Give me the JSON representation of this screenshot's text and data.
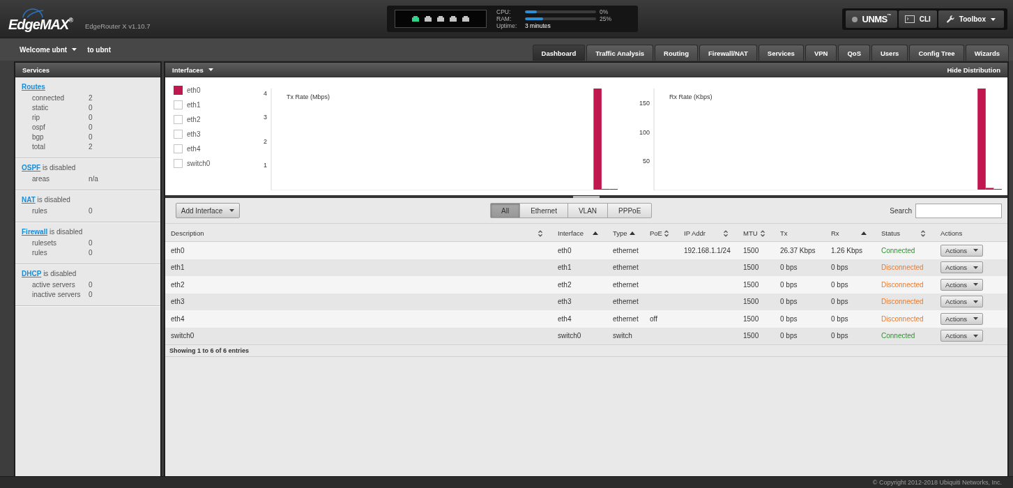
{
  "header": {
    "logo": "EdgeMAX$^{®}$",
    "model": "EdgeRouter X v1.10.7",
    "ports": [
      {
        "link": true
      },
      {
        "link": false
      },
      {
        "link": false
      },
      {
        "link": false
      },
      {
        "link": false
      }
    ],
    "stats": [
      {
        "label": "CPU:",
        "level": 0.17,
        "reading": "0%"
      },
      {
        "label": "RAM:",
        "level": 0.25,
        "reading": "25%"
      }
    ],
    "uptime": {
      "label": "Uptime:",
      "value": "3 minutes"
    },
    "tools": [
      {
        "kind": "unms",
        "label": "UNMS$^{™}$",
        "connected": false
      },
      {
        "kind": "cli",
        "label": "CLI"
      },
      {
        "kind": "toolbox",
        "label": "Toolbox"
      }
    ]
  },
  "user_bar": {
    "welcome": "Welcome ubnt",
    "target": "to ubnt"
  },
  "tabs": [
    {
      "label": "Dashboard",
      "selected": true
    },
    {
      "label": "Traffic Analysis",
      "selected": false
    },
    {
      "label": "Routing",
      "selected": false
    },
    {
      "label": "Firewall/NAT",
      "selected": false
    },
    {
      "label": "Services",
      "selected": false
    },
    {
      "label": "VPN",
      "selected": false
    },
    {
      "label": "QoS",
      "selected": false
    },
    {
      "label": "Users",
      "selected": false
    },
    {
      "label": "Config Tree",
      "selected": false
    },
    {
      "label": "Wizards",
      "selected": false
    }
  ],
  "sidebar": {
    "title": "Services",
    "sections": [
      {
        "link": "Routes",
        "rows": [
          {
            "label": "connected",
            "value": "2"
          },
          {
            "label": "static",
            "value": "0"
          },
          {
            "label": "rip",
            "value": "0"
          },
          {
            "label": "ospf",
            "value": "0"
          },
          {
            "label": "bgp",
            "value": "0"
          },
          {
            "label": "total",
            "value": "2"
          }
        ]
      },
      {
        "link": "OSPF",
        "note": "is disabled",
        "rows": [
          {
            "label": "areas",
            "value": "n/a"
          }
        ]
      },
      {
        "link": "NAT",
        "note": "is disabled",
        "rows": [
          {
            "label": "rules",
            "value": "0"
          }
        ]
      },
      {
        "link": "Firewall",
        "note": "is disabled",
        "rows": [
          {
            "label": "rulesets",
            "value": "0"
          },
          {
            "label": "rules",
            "value": "0"
          }
        ]
      },
      {
        "link": "DHCP",
        "note": "is disabled",
        "rows": [
          {
            "label": "active servers",
            "value": "0"
          },
          {
            "label": "inactive servers",
            "value": "0"
          }
        ]
      }
    ]
  },
  "interfaces_panel": {
    "title": "Interfaces",
    "action": "Hide Distribution",
    "legend": [
      {
        "label": "eth0",
        "checked": true,
        "color": "#c0174f"
      },
      {
        "label": "eth1",
        "checked": false
      },
      {
        "label": "eth2",
        "checked": false
      },
      {
        "label": "eth3",
        "checked": false
      },
      {
        "label": "eth4",
        "checked": false
      },
      {
        "label": "switch0",
        "checked": false
      }
    ],
    "charts": [
      {
        "chart_data": {
          "type": "bar",
          "title": "Tx Rate (Mbps)",
          "categories": [
            null,
            null,
            null,
            null,
            null,
            null,
            null,
            null,
            null,
            null,
            null,
            null,
            null,
            null,
            null,
            null,
            null,
            null,
            null,
            null,
            null,
            null,
            null,
            null,
            null,
            null,
            null,
            null,
            null,
            null,
            null,
            null,
            null,
            null,
            null,
            null,
            null,
            null,
            null,
            null,
            null,
            null,
            null
          ],
          "series": [
            {
              "color": "#c0174f",
              "values": [
                null,
                null,
                null,
                null,
                null,
                null,
                null,
                null,
                null,
                null,
                null,
                null,
                null,
                null,
                null,
                null,
                null,
                null,
                null,
                null,
                null,
                null,
                null,
                null,
                null,
                null,
                null,
                null,
                null,
                null,
                null,
                null,
                null,
                null,
                null,
                null,
                null,
                null,
                null,
                null,
                4.2,
                0.03,
                0.02
              ]
            }
          ],
          "ylim": [
            0,
            4.2
          ],
          "yticks": [
            1,
            2,
            3,
            4
          ]
        }
      },
      {
        "chart_data": {
          "type": "bar",
          "title": "Rx Rate (Kbps)",
          "categories": [
            null,
            null,
            null,
            null,
            null,
            null,
            null,
            null,
            null,
            null,
            null,
            null,
            null,
            null,
            null,
            null,
            null,
            null,
            null,
            null,
            null,
            null,
            null,
            null,
            null,
            null,
            null,
            null,
            null,
            null,
            null,
            null,
            null,
            null,
            null,
            null,
            null,
            null,
            null,
            null,
            null,
            null,
            null
          ],
          "series": [
            {
              "color": "#c0174f",
              "values": [
                null,
                null,
                null,
                null,
                null,
                null,
                null,
                null,
                null,
                null,
                null,
                null,
                null,
                null,
                null,
                null,
                null,
                null,
                null,
                null,
                null,
                null,
                null,
                null,
                null,
                null,
                null,
                null,
                null,
                null,
                null,
                null,
                null,
                null,
                null,
                null,
                null,
                null,
                null,
                null,
                176,
                3,
                1
              ]
            }
          ],
          "ylim": [
            0,
            176
          ],
          "yticks": [
            50,
            100,
            150
          ]
        }
      }
    ]
  },
  "table": {
    "add_button": "Add Interface",
    "filters": [
      {
        "label": "All",
        "selected": true
      },
      {
        "label": "Ethernet",
        "selected": false
      },
      {
        "label": "VLAN",
        "selected": false
      },
      {
        "label": "PPPoE",
        "selected": false
      }
    ],
    "search": {
      "label": "Search"
    },
    "columns": [
      {
        "label": "Description",
        "sortable": true,
        "sorted": false
      },
      {
        "label": "Interface",
        "sortable": true,
        "sorted": true
      },
      {
        "label": "Type",
        "sortable": true,
        "sorted": true
      },
      {
        "label": "PoE",
        "sortable": true,
        "sorted": false
      },
      {
        "label": "IP Addr",
        "sortable": true,
        "sorted": false
      },
      {
        "label": "MTU",
        "sortable": true,
        "sorted": false
      },
      {
        "label": "Tx",
        "sortable": false,
        "sorted": false
      },
      {
        "label": "Rx",
        "sortable": true,
        "sorted": true
      },
      {
        "label": "Status",
        "sortable": true,
        "sorted": false
      },
      {
        "label": "Actions",
        "sortable": false,
        "sorted": false
      }
    ],
    "rows": [
      {
        "description": "eth0",
        "interface": "eth0",
        "type": "ethernet",
        "ip_addr": "192.168.1.1/24",
        "mtu": "1500",
        "tx": "26.37 Kbps",
        "rx": "1.26 Kbps",
        "status": "Connected",
        "connected": true,
        "action": "Actions"
      },
      {
        "description": "eth1",
        "interface": "eth1",
        "type": "ethernet",
        "mtu": "1500",
        "tx": "0 bps",
        "rx": "0 bps",
        "status": "Disconnected",
        "connected": false,
        "action": "Actions"
      },
      {
        "description": "eth2",
        "interface": "eth2",
        "type": "ethernet",
        "mtu": "1500",
        "tx": "0 bps",
        "rx": "0 bps",
        "status": "Disconnected",
        "connected": false,
        "action": "Actions"
      },
      {
        "description": "eth3",
        "interface": "eth3",
        "type": "ethernet",
        "mtu": "1500",
        "tx": "0 bps",
        "rx": "0 bps",
        "status": "Disconnected",
        "connected": false,
        "action": "Actions"
      },
      {
        "description": "eth4",
        "interface": "eth4",
        "type": "ethernet",
        "poe": "off",
        "mtu": "1500",
        "tx": "0 bps",
        "rx": "0 bps",
        "status": "Disconnected",
        "connected": false,
        "action": "Actions"
      },
      {
        "description": "switch0",
        "interface": "switch0",
        "type": "switch",
        "mtu": "1500",
        "tx": "0 bps",
        "rx": "0 bps",
        "status": "Connected",
        "connected": true,
        "action": "Actions"
      }
    ],
    "info": "Showing 1 to 6 of 6 entries"
  },
  "footer": {
    "copyright": "© Copyright 2012-2018 Ubiquiti Networks, Inc."
  }
}
